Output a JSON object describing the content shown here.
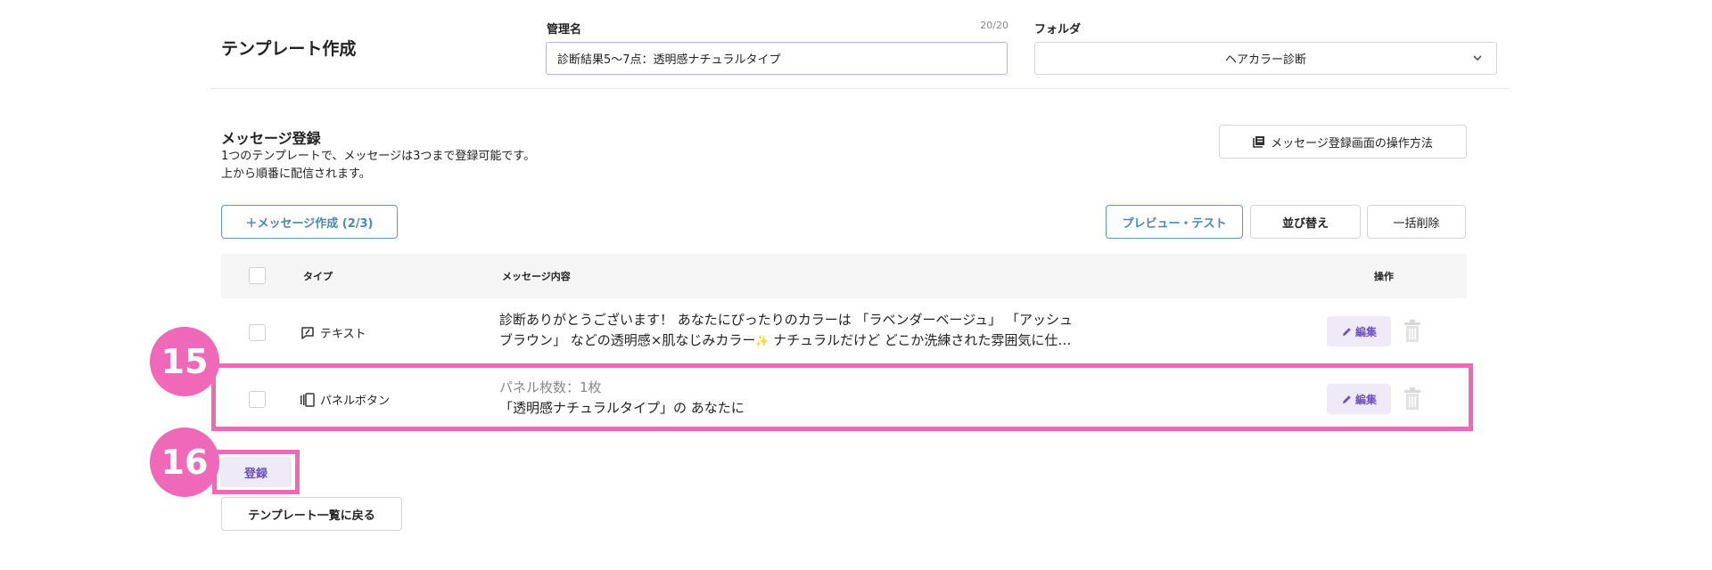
{
  "header": {
    "title": "テンプレート作成",
    "name_label": "管理名",
    "name_counter": "20/20",
    "name_value": "診断結果5〜7点：透明感ナチュラルタイプ",
    "folder_label": "フォルダ",
    "folder_value": "ヘアカラー診断"
  },
  "messages": {
    "title": "メッセージ登録",
    "desc_line1": "1つのテンプレートで、メッセージは3つまで登録可能です。",
    "desc_line2": "上から順番に配信されます。",
    "howto_label": "メッセージ登録画面の操作方法",
    "create_label": "＋メッセージ作成 (2/3)",
    "preview_label": "プレビュー・テスト",
    "sort_label": "並び替え",
    "bulk_delete_label": "一括削除"
  },
  "table": {
    "columns": {
      "type": "タイプ",
      "content": "メッセージ内容",
      "actions": "操作"
    },
    "rows": [
      {
        "type": "テキスト",
        "line1": "診断ありがとうございます！ あなたにぴったりのカラーは 「ラベンダーベージュ」 「アッシュ",
        "line2a": "ブラウン」 などの透明感×肌なじみカラー",
        "sparkle": "✨",
        "line2b": " ナチュラルだけど どこか洗練された雰囲気に仕…",
        "edit_label": "編集"
      },
      {
        "type": "パネルボタン",
        "line1": "パネル枚数：1枚",
        "line2": "「透明感ナチュラルタイプ」の あなたに",
        "edit_label": "編集"
      }
    ]
  },
  "annotations": {
    "badge_a": "15",
    "badge_b": "16"
  },
  "footer": {
    "register_label": "登録",
    "back_label": "テンプレート一覧に戻る"
  },
  "colors": {
    "accent": "#f068b8",
    "brand_purple": "#7050c0",
    "outline_blue": "#5b9bbf"
  }
}
